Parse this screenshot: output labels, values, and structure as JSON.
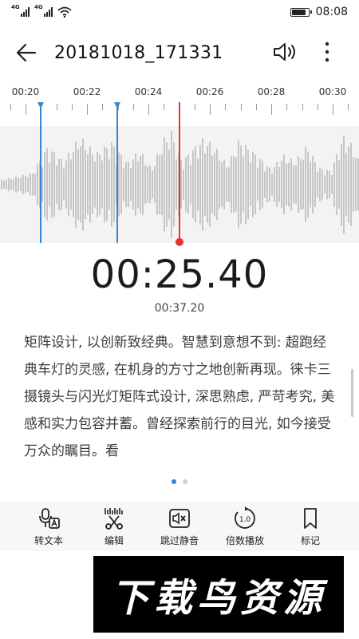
{
  "status_bar": {
    "network_1": "4G",
    "network_2": "4G",
    "time": "08:08",
    "battery_level": 0.9
  },
  "header": {
    "title": "20181018_171331",
    "back_icon": "arrow-left-icon",
    "speaker_icon": "speaker-icon",
    "more_icon": "more-vertical-icon"
  },
  "timeline": {
    "labels": [
      "00:20",
      "00:22",
      "00:24",
      "00:26",
      "00:28",
      "00:30"
    ]
  },
  "player": {
    "current_time": "00:25.40",
    "total_time": "00:37.20",
    "marker_color": "#2f86d6",
    "playhead_color": "#e3342f"
  },
  "transcript": {
    "text": "矩阵设计, 以创新致经典。智慧到意想不到: 超跑经典车灯的灵感, 在机身的方寸之地创新再现。徕卡三摄镜头与闪光灯矩阵式设计, 深思熟虑, 严苛考究, 美感和实力包容并蓄。曾经探索前行的目光, 如今接受万众的瞩目。看"
  },
  "pager": {
    "pages": 2,
    "active": 1
  },
  "toolbar": {
    "items": [
      {
        "label": "转文本",
        "icon": "mic-to-text-icon"
      },
      {
        "label": "编辑",
        "icon": "scissors-icon"
      },
      {
        "label": "跳过静音",
        "icon": "skip-silence-icon"
      },
      {
        "label": "倍数播放",
        "icon": "speed-1.0-icon"
      },
      {
        "label": "标记",
        "icon": "bookmark-icon"
      }
    ]
  },
  "watermark": {
    "text": "下载鸟资源"
  }
}
